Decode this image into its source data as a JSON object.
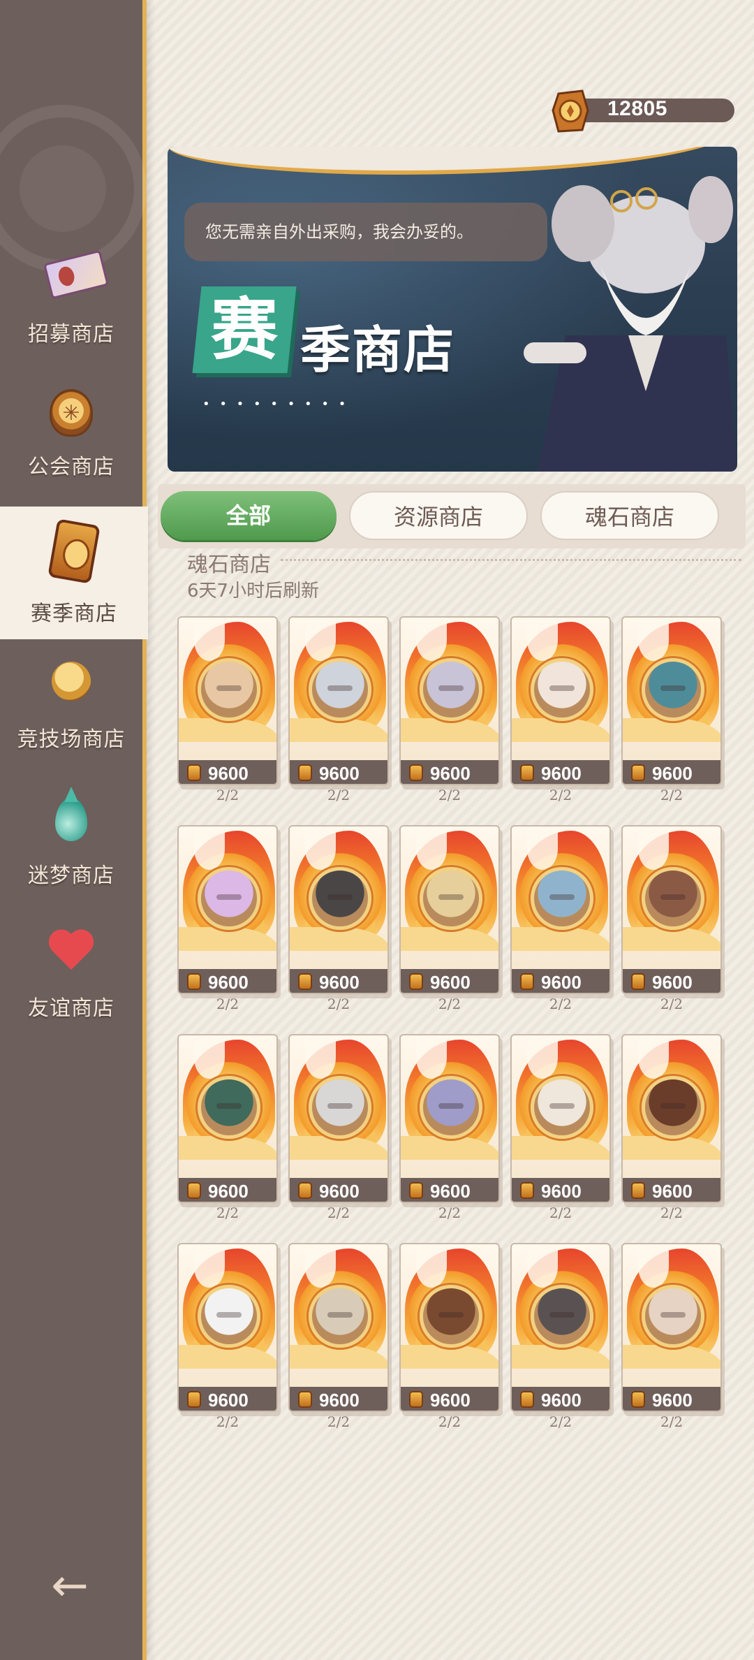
{
  "currency": {
    "amount": "12805",
    "icon": "season-coin-icon"
  },
  "banner": {
    "dialogue": "您无需亲自外出采购，我会办妥的。",
    "title_first": "赛",
    "title_rest": "季商店",
    "title_dots": "• • • • • • • • •"
  },
  "sidebar": {
    "items": [
      {
        "label": "招募商店",
        "icon": "ticket-icon"
      },
      {
        "label": "公会商店",
        "icon": "guild-badge-icon"
      },
      {
        "label": "赛季商店",
        "icon": "season-token-icon",
        "active": true
      },
      {
        "label": "竞技场商店",
        "icon": "arena-coin-icon"
      },
      {
        "label": "迷梦商店",
        "icon": "dream-drop-icon"
      },
      {
        "label": "友谊商店",
        "icon": "heart-icon"
      }
    ],
    "back": "←"
  },
  "tabs": [
    {
      "label": "全部",
      "active": true
    },
    {
      "label": "资源商店",
      "active": false
    },
    {
      "label": "魂石商店",
      "active": false
    }
  ],
  "section": {
    "title": "魂石商店",
    "refresh": "6天7小时后刷新"
  },
  "items": [
    {
      "price": "9600",
      "stock": "2/2",
      "tone": "#e8c8a4"
    },
    {
      "price": "9600",
      "stock": "2/2",
      "tone": "#cfd3dc"
    },
    {
      "price": "9600",
      "stock": "2/2",
      "tone": "#c9c3d8"
    },
    {
      "price": "9600",
      "stock": "2/2",
      "tone": "#f1e4da"
    },
    {
      "price": "9600",
      "stock": "2/2",
      "tone": "#4f8c99"
    },
    {
      "price": "9600",
      "stock": "2/2",
      "tone": "#dcb8e6"
    },
    {
      "price": "9600",
      "stock": "2/2",
      "tone": "#4b4646"
    },
    {
      "price": "9600",
      "stock": "2/2",
      "tone": "#e6cf9a"
    },
    {
      "price": "9600",
      "stock": "2/2",
      "tone": "#8fb3cc"
    },
    {
      "price": "9600",
      "stock": "2/2",
      "tone": "#8b5a45"
    },
    {
      "price": "9600",
      "stock": "2/2",
      "tone": "#3f6a5c"
    },
    {
      "price": "9600",
      "stock": "2/2",
      "tone": "#d9d6d6"
    },
    {
      "price": "9600",
      "stock": "2/2",
      "tone": "#9f9cc9"
    },
    {
      "price": "9600",
      "stock": "2/2",
      "tone": "#efe6dc"
    },
    {
      "price": "9600",
      "stock": "2/2",
      "tone": "#6a3d2a"
    },
    {
      "price": "9600",
      "stock": "2/2",
      "tone": "#f2f2f2"
    },
    {
      "price": "9600",
      "stock": "2/2",
      "tone": "#d8cbb8"
    },
    {
      "price": "9600",
      "stock": "2/2",
      "tone": "#7a4a30"
    },
    {
      "price": "9600",
      "stock": "2/2",
      "tone": "#5a5252"
    },
    {
      "price": "9600",
      "stock": "2/2",
      "tone": "#e7d3c3"
    }
  ]
}
